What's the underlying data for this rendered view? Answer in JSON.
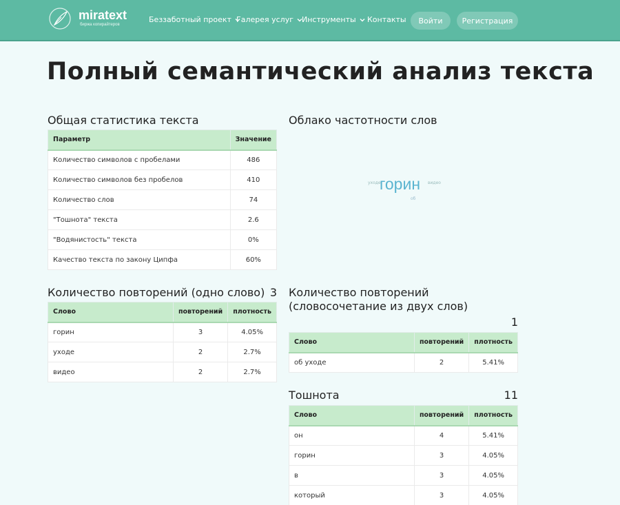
{
  "header": {
    "logo_name": "miratext",
    "logo_sub": "биржа копирайтеров",
    "nav": [
      {
        "label": "Беззаботный проект"
      },
      {
        "label": "Галерея услуг"
      },
      {
        "label": "Инструменты"
      },
      {
        "label": "Контакты"
      }
    ],
    "login_label": "Войти",
    "register_label": "Регистрация",
    "color": "#5dbaa3"
  },
  "page_title": "Полный семантический анализ текста",
  "stats": {
    "title": "Общая статистика текста",
    "columns": [
      "Параметр",
      "Значение"
    ],
    "rows": [
      [
        "Количество символов с пробелами",
        "486"
      ],
      [
        "Количество символов без пробелов",
        "410"
      ],
      [
        "Количество слов",
        "74"
      ],
      [
        "\"Тошнота\" текста",
        "2.6"
      ],
      [
        "\"Водянистость\" текста",
        "0%"
      ],
      [
        "Качество текста по закону Ципфа",
        "60%"
      ]
    ]
  },
  "cloud": {
    "title": "Облако частотности слов",
    "words": [
      {
        "text": "уходе"
      },
      {
        "text": "горин"
      },
      {
        "text": "видео"
      },
      {
        "text": "об"
      }
    ]
  },
  "single": {
    "title": "Количество повторений (одно слово)",
    "count": "3",
    "columns": [
      "Слово",
      "повторений",
      "плотность"
    ],
    "rows": [
      [
        "горин",
        "3",
        "4.05%"
      ],
      [
        "уходе",
        "2",
        "2.7%"
      ],
      [
        "видео",
        "2",
        "2.7%"
      ]
    ]
  },
  "pairs": {
    "title_line1": "Количество повторений",
    "title_line2": "(словосочетание из двух слов)",
    "count": "1",
    "columns": [
      "Слово",
      "повторений",
      "плотность"
    ],
    "rows": [
      [
        "об уходе",
        "2",
        "5.41%"
      ]
    ]
  },
  "nausea": {
    "title": "Тошнота",
    "count": "11",
    "columns": [
      "Слово",
      "повторений",
      "плотность"
    ],
    "rows": [
      [
        "он",
        "4",
        "5.41%"
      ],
      [
        "горин",
        "3",
        "4.05%"
      ],
      [
        "в",
        "3",
        "4.05%"
      ],
      [
        "который",
        "3",
        "4.05%"
      ]
    ]
  }
}
